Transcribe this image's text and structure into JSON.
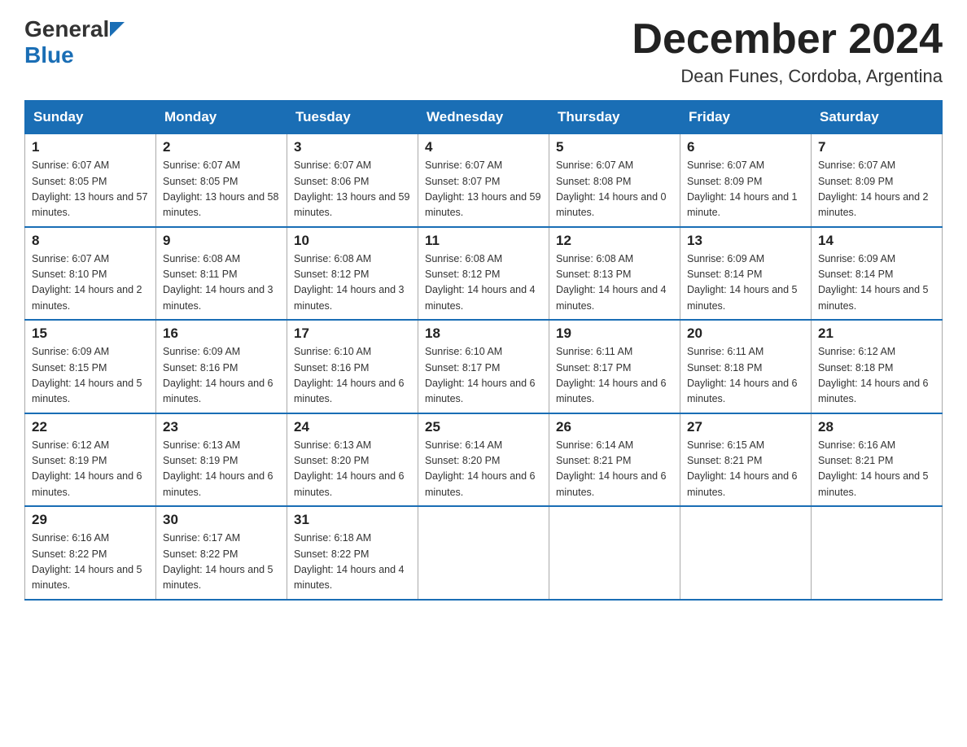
{
  "header": {
    "logo_general": "General",
    "logo_blue": "Blue",
    "title": "December 2024",
    "subtitle": "Dean Funes, Cordoba, Argentina"
  },
  "days_of_week": [
    "Sunday",
    "Monday",
    "Tuesday",
    "Wednesday",
    "Thursday",
    "Friday",
    "Saturday"
  ],
  "weeks": [
    [
      {
        "day": "1",
        "sunrise": "6:07 AM",
        "sunset": "8:05 PM",
        "daylight": "13 hours and 57 minutes."
      },
      {
        "day": "2",
        "sunrise": "6:07 AM",
        "sunset": "8:05 PM",
        "daylight": "13 hours and 58 minutes."
      },
      {
        "day": "3",
        "sunrise": "6:07 AM",
        "sunset": "8:06 PM",
        "daylight": "13 hours and 59 minutes."
      },
      {
        "day": "4",
        "sunrise": "6:07 AM",
        "sunset": "8:07 PM",
        "daylight": "13 hours and 59 minutes."
      },
      {
        "day": "5",
        "sunrise": "6:07 AM",
        "sunset": "8:08 PM",
        "daylight": "14 hours and 0 minutes."
      },
      {
        "day": "6",
        "sunrise": "6:07 AM",
        "sunset": "8:09 PM",
        "daylight": "14 hours and 1 minute."
      },
      {
        "day": "7",
        "sunrise": "6:07 AM",
        "sunset": "8:09 PM",
        "daylight": "14 hours and 2 minutes."
      }
    ],
    [
      {
        "day": "8",
        "sunrise": "6:07 AM",
        "sunset": "8:10 PM",
        "daylight": "14 hours and 2 minutes."
      },
      {
        "day": "9",
        "sunrise": "6:08 AM",
        "sunset": "8:11 PM",
        "daylight": "14 hours and 3 minutes."
      },
      {
        "day": "10",
        "sunrise": "6:08 AM",
        "sunset": "8:12 PM",
        "daylight": "14 hours and 3 minutes."
      },
      {
        "day": "11",
        "sunrise": "6:08 AM",
        "sunset": "8:12 PM",
        "daylight": "14 hours and 4 minutes."
      },
      {
        "day": "12",
        "sunrise": "6:08 AM",
        "sunset": "8:13 PM",
        "daylight": "14 hours and 4 minutes."
      },
      {
        "day": "13",
        "sunrise": "6:09 AM",
        "sunset": "8:14 PM",
        "daylight": "14 hours and 5 minutes."
      },
      {
        "day": "14",
        "sunrise": "6:09 AM",
        "sunset": "8:14 PM",
        "daylight": "14 hours and 5 minutes."
      }
    ],
    [
      {
        "day": "15",
        "sunrise": "6:09 AM",
        "sunset": "8:15 PM",
        "daylight": "14 hours and 5 minutes."
      },
      {
        "day": "16",
        "sunrise": "6:09 AM",
        "sunset": "8:16 PM",
        "daylight": "14 hours and 6 minutes."
      },
      {
        "day": "17",
        "sunrise": "6:10 AM",
        "sunset": "8:16 PM",
        "daylight": "14 hours and 6 minutes."
      },
      {
        "day": "18",
        "sunrise": "6:10 AM",
        "sunset": "8:17 PM",
        "daylight": "14 hours and 6 minutes."
      },
      {
        "day": "19",
        "sunrise": "6:11 AM",
        "sunset": "8:17 PM",
        "daylight": "14 hours and 6 minutes."
      },
      {
        "day": "20",
        "sunrise": "6:11 AM",
        "sunset": "8:18 PM",
        "daylight": "14 hours and 6 minutes."
      },
      {
        "day": "21",
        "sunrise": "6:12 AM",
        "sunset": "8:18 PM",
        "daylight": "14 hours and 6 minutes."
      }
    ],
    [
      {
        "day": "22",
        "sunrise": "6:12 AM",
        "sunset": "8:19 PM",
        "daylight": "14 hours and 6 minutes."
      },
      {
        "day": "23",
        "sunrise": "6:13 AM",
        "sunset": "8:19 PM",
        "daylight": "14 hours and 6 minutes."
      },
      {
        "day": "24",
        "sunrise": "6:13 AM",
        "sunset": "8:20 PM",
        "daylight": "14 hours and 6 minutes."
      },
      {
        "day": "25",
        "sunrise": "6:14 AM",
        "sunset": "8:20 PM",
        "daylight": "14 hours and 6 minutes."
      },
      {
        "day": "26",
        "sunrise": "6:14 AM",
        "sunset": "8:21 PM",
        "daylight": "14 hours and 6 minutes."
      },
      {
        "day": "27",
        "sunrise": "6:15 AM",
        "sunset": "8:21 PM",
        "daylight": "14 hours and 6 minutes."
      },
      {
        "day": "28",
        "sunrise": "6:16 AM",
        "sunset": "8:21 PM",
        "daylight": "14 hours and 5 minutes."
      }
    ],
    [
      {
        "day": "29",
        "sunrise": "6:16 AM",
        "sunset": "8:22 PM",
        "daylight": "14 hours and 5 minutes."
      },
      {
        "day": "30",
        "sunrise": "6:17 AM",
        "sunset": "8:22 PM",
        "daylight": "14 hours and 5 minutes."
      },
      {
        "day": "31",
        "sunrise": "6:18 AM",
        "sunset": "8:22 PM",
        "daylight": "14 hours and 4 minutes."
      },
      null,
      null,
      null,
      null
    ]
  ],
  "labels": {
    "sunrise_prefix": "Sunrise: ",
    "sunset_prefix": "Sunset: ",
    "daylight_prefix": "Daylight: "
  }
}
